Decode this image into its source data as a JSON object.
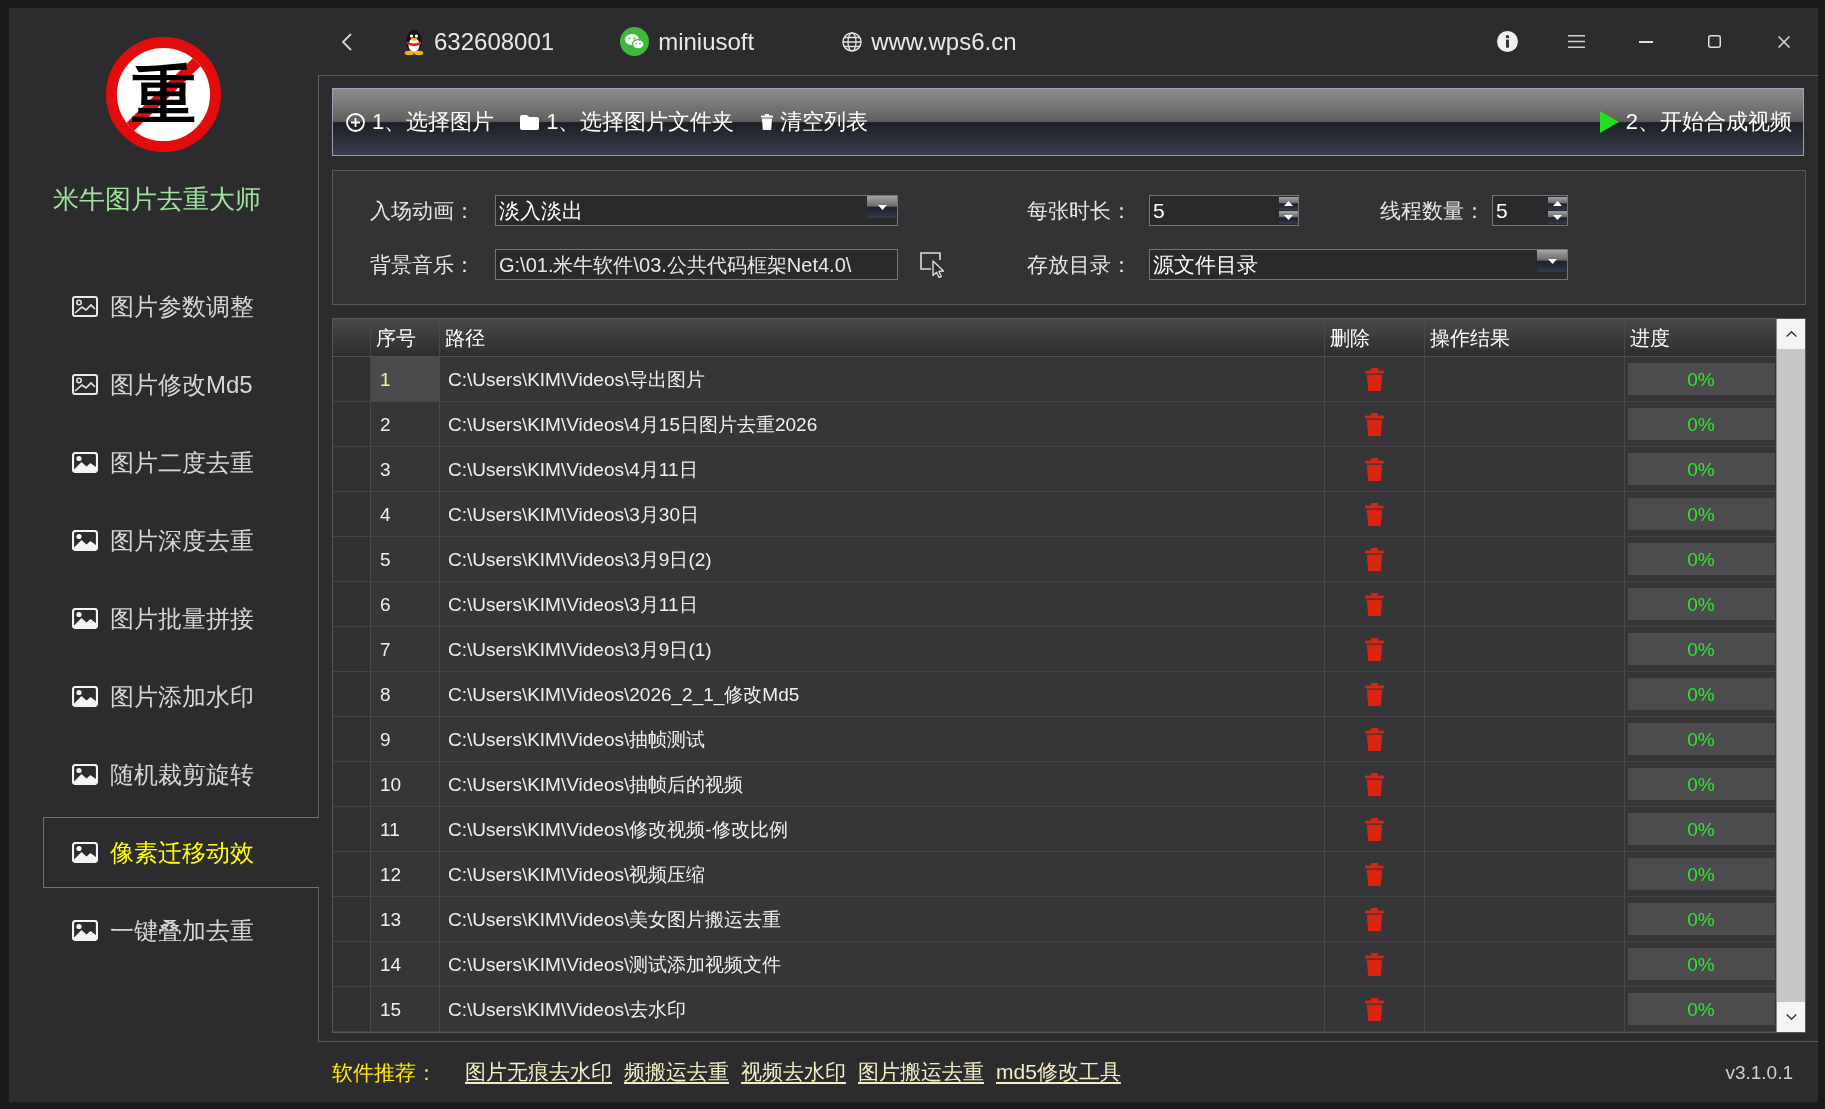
{
  "sidebar": {
    "logo_text": "重",
    "title": "米牛图片去重大师",
    "items": [
      {
        "label": "图片参数调整",
        "kind": "outline",
        "selected": false
      },
      {
        "label": "图片修改Md5",
        "kind": "outline",
        "selected": false
      },
      {
        "label": "图片二度去重",
        "kind": "filled",
        "selected": false
      },
      {
        "label": "图片深度去重",
        "kind": "filled",
        "selected": false
      },
      {
        "label": "图片批量拼接",
        "kind": "filled",
        "selected": false
      },
      {
        "label": "图片添加水印",
        "kind": "filled",
        "selected": false
      },
      {
        "label": "随机裁剪旋转",
        "kind": "filled",
        "selected": false
      },
      {
        "label": "像素迁移动效",
        "kind": "filled",
        "selected": true
      },
      {
        "label": "一键叠加去重",
        "kind": "filled",
        "selected": false
      }
    ]
  },
  "header": {
    "contacts": [
      {
        "kind": "qq",
        "text": "632608001"
      },
      {
        "kind": "wechat",
        "text": "miniusoft"
      },
      {
        "kind": "web",
        "text": "www.wps6.cn"
      }
    ]
  },
  "toolbar": {
    "left_buttons": [
      {
        "kind": "add",
        "label": "1、选择图片"
      },
      {
        "kind": "folder",
        "label": "1、选择图片文件夹"
      },
      {
        "kind": "clear",
        "label": "清空列表"
      }
    ],
    "right_buttons": [
      {
        "kind": "start",
        "label": "2、开始合成视频"
      }
    ]
  },
  "settings": {
    "rows": [
      [
        {
          "label": "入场动画：",
          "kind": "dropdown",
          "value": "淡入淡出"
        },
        {
          "label": "每张时长：",
          "kind": "spin",
          "value": "5"
        },
        {
          "label": "线程数量：",
          "kind": "spin",
          "value": "5"
        }
      ],
      [
        {
          "label": "背景音乐：",
          "kind": "path",
          "value": "G:\\01.米牛软件\\03.公共代码框架Net4.0\\"
        },
        {
          "label": "存放目录：",
          "kind": "dropdown",
          "value": "源文件目录"
        }
      ]
    ]
  },
  "table": {
    "columns": [
      "序号",
      "路径",
      "删除",
      "操作结果",
      "进度"
    ],
    "rows": [
      {
        "index": "1",
        "path": "C:\\Users\\KIM\\Videos\\导出图片",
        "selected": true,
        "progress": {
          "level": 0,
          "reading": "0%"
        }
      },
      {
        "index": "2",
        "path": "C:\\Users\\KIM\\Videos\\4月15日图片去重2026",
        "selected": false,
        "progress": {
          "level": 0,
          "reading": "0%"
        }
      },
      {
        "index": "3",
        "path": "C:\\Users\\KIM\\Videos\\4月11日",
        "selected": false,
        "progress": {
          "level": 0,
          "reading": "0%"
        }
      },
      {
        "index": "4",
        "path": "C:\\Users\\KIM\\Videos\\3月30日",
        "selected": false,
        "progress": {
          "level": 0,
          "reading": "0%"
        }
      },
      {
        "index": "5",
        "path": "C:\\Users\\KIM\\Videos\\3月9日(2)",
        "selected": false,
        "progress": {
          "level": 0,
          "reading": "0%"
        }
      },
      {
        "index": "6",
        "path": "C:\\Users\\KIM\\Videos\\3月11日",
        "selected": false,
        "progress": {
          "level": 0,
          "reading": "0%"
        }
      },
      {
        "index": "7",
        "path": "C:\\Users\\KIM\\Videos\\3月9日(1)",
        "selected": false,
        "progress": {
          "level": 0,
          "reading": "0%"
        }
      },
      {
        "index": "8",
        "path": "C:\\Users\\KIM\\Videos\\2026_2_1_修改Md5",
        "selected": false,
        "progress": {
          "level": 0,
          "reading": "0%"
        }
      },
      {
        "index": "9",
        "path": "C:\\Users\\KIM\\Videos\\抽帧测试",
        "selected": false,
        "progress": {
          "level": 0,
          "reading": "0%"
        }
      },
      {
        "index": "10",
        "path": "C:\\Users\\KIM\\Videos\\抽帧后的视频",
        "selected": false,
        "progress": {
          "level": 0,
          "reading": "0%"
        }
      },
      {
        "index": "11",
        "path": "C:\\Users\\KIM\\Videos\\修改视频-修改比例",
        "selected": false,
        "progress": {
          "level": 0,
          "reading": "0%"
        }
      },
      {
        "index": "12",
        "path": "C:\\Users\\KIM\\Videos\\视频压缩",
        "selected": false,
        "progress": {
          "level": 0,
          "reading": "0%"
        }
      },
      {
        "index": "13",
        "path": "C:\\Users\\KIM\\Videos\\美女图片搬运去重",
        "selected": false,
        "progress": {
          "level": 0,
          "reading": "0%"
        }
      },
      {
        "index": "14",
        "path": "C:\\Users\\KIM\\Videos\\测试添加视频文件",
        "selected": false,
        "progress": {
          "level": 0,
          "reading": "0%"
        }
      },
      {
        "index": "15",
        "path": "C:\\Users\\KIM\\Videos\\去水印",
        "selected": false,
        "progress": {
          "level": 0,
          "reading": "0%"
        }
      }
    ]
  },
  "footer": {
    "label": "软件推荐：",
    "links": [
      "图片无痕去水印",
      "频搬运去重",
      "视频去水印",
      "图片搬运去重",
      "md5修改工具"
    ],
    "version": "v3.1.0.1"
  }
}
